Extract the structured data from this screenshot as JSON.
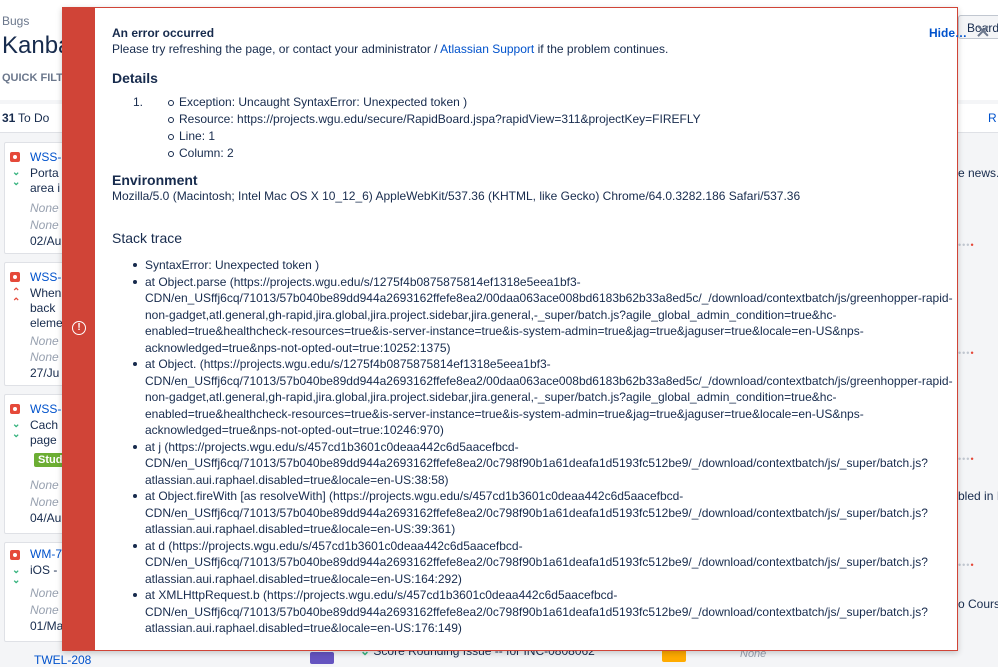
{
  "board": {
    "project": "Bugs",
    "title": "Kanban",
    "quick_filters": "QUICK FILTE",
    "board_button": "Board",
    "column": {
      "count": "31",
      "label": "To Do",
      "right_link": "R"
    },
    "cards": [
      {
        "key": "WSS-",
        "summary": [
          "Porta",
          "area i"
        ],
        "none1": "None",
        "none2": "None",
        "date": "02/Au"
      },
      {
        "key": "WSS-",
        "summary": [
          "When",
          "back",
          "eleme"
        ],
        "none1": "None",
        "none2": "None",
        "date": "27/Ju"
      },
      {
        "key": "WSS-",
        "summary": [
          "Cach",
          "page"
        ],
        "badge": "Stud",
        "none1": "None",
        "none2": "None",
        "date": "04/Au"
      },
      {
        "key": "WM-7",
        "summary": [
          "iOS -"
        ],
        "none1": "None",
        "none2": "None",
        "date": "01/Ma"
      }
    ],
    "right_snippets": {
      "news": "e news.",
      "ib": "bled in IE",
      "course": "o Cours"
    },
    "bottom": {
      "key": "TWEL-208",
      "row": "Score Rounding Issue -- for INC-0808062",
      "none": "None"
    }
  },
  "error_flag": {
    "title": "An error occurred",
    "message_prefix": "Please try refreshing the page, or contact your administrator /",
    "support_link": "Atlassian Support",
    "message_suffix": "if the problem continues.",
    "hide_label": "Hide…",
    "icon": "error-icon",
    "details_heading": "Details",
    "details_number": "1.",
    "details": [
      "Exception: Uncaught SyntaxError: Unexpected token )",
      "Resource: https://projects.wgu.edu/secure/RapidBoard.jspa?rapidView=311&projectKey=FIREFLY",
      "Line: 1",
      "Column: 2"
    ],
    "environment_heading": "Environment",
    "environment": "Mozilla/5.0 (Macintosh; Intel Mac OS X 10_12_6) AppleWebKit/537.36 (KHTML, like Gecko) Chrome/64.0.3282.186 Safari/537.36",
    "stack_heading": "Stack trace",
    "stack": [
      [
        "SyntaxError: Unexpected token )"
      ],
      [
        "at Object.parse (https://projects.wgu.edu/s/1275f4b0875875814ef1318e5eea1bf3-",
        "CDN/en_USffj6cq/71013/57b040be89dd944a2693162ffefe8ea2/00daa063ace008bd6183b62b33a8ed5c/_/download/contextbatch/js/greenhopper-rapid-",
        "non-gadget,atl.general,gh-rapid,jira.global,jira.project.sidebar,jira.general,-_super/batch.js?agile_global_admin_condition=true&hc-",
        "enabled=true&healthcheck-resources=true&is-server-instance=true&is-system-admin=true&jag=true&jaguser=true&locale=en-US&nps-",
        "acknowledged=true&nps-not-opted-out=true:10252:1375)"
      ],
      [
        "at Object. (https://projects.wgu.edu/s/1275f4b0875875814ef1318e5eea1bf3-",
        "CDN/en_USffj6cq/71013/57b040be89dd944a2693162ffefe8ea2/00daa063ace008bd6183b62b33a8ed5c/_/download/contextbatch/js/greenhopper-rapid-",
        "non-gadget,atl.general,gh-rapid,jira.global,jira.project.sidebar,jira.general,-_super/batch.js?agile_global_admin_condition=true&hc-",
        "enabled=true&healthcheck-resources=true&is-server-instance=true&is-system-admin=true&jag=true&jaguser=true&locale=en-US&nps-",
        "acknowledged=true&nps-not-opted-out=true:10246:970)"
      ],
      [
        "at j (https://projects.wgu.edu/s/457cd1b3601c0deaa442c6d5aacefbcd-",
        "CDN/en_USffj6cq/71013/57b040be89dd944a2693162ffefe8ea2/0c798f90b1a61deafa1d5193fc512be9/_/download/contextbatch/js/_super/batch.js?",
        "atlassian.aui.raphael.disabled=true&locale=en-US:38:58)"
      ],
      [
        "at Object.fireWith [as resolveWith] (https://projects.wgu.edu/s/457cd1b3601c0deaa442c6d5aacefbcd-",
        "CDN/en_USffj6cq/71013/57b040be89dd944a2693162ffefe8ea2/0c798f90b1a61deafa1d5193fc512be9/_/download/contextbatch/js/_super/batch.js?",
        "atlassian.aui.raphael.disabled=true&locale=en-US:39:361)"
      ],
      [
        "at d (https://projects.wgu.edu/s/457cd1b3601c0deaa442c6d5aacefbcd-",
        "CDN/en_USffj6cq/71013/57b040be89dd944a2693162ffefe8ea2/0c798f90b1a61deafa1d5193fc512be9/_/download/contextbatch/js/_super/batch.js?",
        "atlassian.aui.raphael.disabled=true&locale=en-US:164:292)"
      ],
      [
        "at XMLHttpRequest.b (https://projects.wgu.edu/s/457cd1b3601c0deaa442c6d5aacefbcd-",
        "CDN/en_USffj6cq/71013/57b040be89dd944a2693162ffefe8ea2/0c798f90b1a61deafa1d5193fc512be9/_/download/contextbatch/js/_super/batch.js?",
        "atlassian.aui.raphael.disabled=true&locale=en-US:176:149)"
      ]
    ]
  }
}
